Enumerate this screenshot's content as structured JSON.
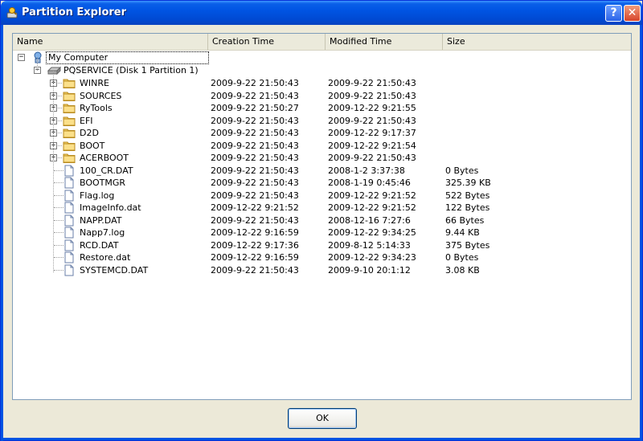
{
  "window": {
    "title": "Partition Explorer",
    "help_label": "?",
    "close_label": "✕"
  },
  "columns": [
    "Name",
    "Creation Time",
    "Modified Time",
    "Size"
  ],
  "tree": {
    "root": {
      "label": "My Computer",
      "expander": "−"
    },
    "partition": {
      "label": "PQSERVICE (Disk 1 Partition 1)",
      "expander": "−"
    }
  },
  "folders": [
    {
      "name": "WINRE",
      "created": "2009-9-22 21:50:43",
      "modified": "2009-9-22 21:50:43",
      "size": ""
    },
    {
      "name": "SOURCES",
      "created": "2009-9-22 21:50:43",
      "modified": "2009-9-22 21:50:43",
      "size": ""
    },
    {
      "name": "RyTools",
      "created": "2009-9-22 21:50:27",
      "modified": "2009-12-22 9:21:55",
      "size": ""
    },
    {
      "name": "EFI",
      "created": "2009-9-22 21:50:43",
      "modified": "2009-9-22 21:50:43",
      "size": ""
    },
    {
      "name": "D2D",
      "created": "2009-9-22 21:50:43",
      "modified": "2009-12-22 9:17:37",
      "size": ""
    },
    {
      "name": "BOOT",
      "created": "2009-9-22 21:50:43",
      "modified": "2009-12-22 9:21:54",
      "size": ""
    },
    {
      "name": "ACERBOOT",
      "created": "2009-9-22 21:50:43",
      "modified": "2009-9-22 21:50:43",
      "size": ""
    }
  ],
  "files": [
    {
      "name": "100_CR.DAT",
      "created": "2009-9-22 21:50:43",
      "modified": "2008-1-2 3:37:38",
      "size": "0 Bytes"
    },
    {
      "name": "BOOTMGR",
      "created": "2009-9-22 21:50:43",
      "modified": "2008-1-19 0:45:46",
      "size": "325.39 KB"
    },
    {
      "name": "Flag.log",
      "created": "2009-9-22 21:50:43",
      "modified": "2009-12-22 9:21:52",
      "size": "522 Bytes"
    },
    {
      "name": "ImageInfo.dat",
      "created": "2009-12-22 9:21:52",
      "modified": "2009-12-22 9:21:52",
      "size": "122 Bytes"
    },
    {
      "name": "NAPP.DAT",
      "created": "2009-9-22 21:50:43",
      "modified": "2008-12-16 7:27:6",
      "size": "66 Bytes"
    },
    {
      "name": "Napp7.log",
      "created": "2009-12-22 9:16:59",
      "modified": "2009-12-22 9:34:25",
      "size": "9.44 KB"
    },
    {
      "name": "RCD.DAT",
      "created": "2009-12-22 9:17:36",
      "modified": "2009-8-12 5:14:33",
      "size": "375 Bytes"
    },
    {
      "name": "Restore.dat",
      "created": "2009-12-22 9:16:59",
      "modified": "2009-12-22 9:34:23",
      "size": "0 Bytes"
    },
    {
      "name": "SYSTEMCD.DAT",
      "created": "2009-9-22 21:50:43",
      "modified": "2009-9-10 20:1:12",
      "size": "3.08 KB"
    }
  ],
  "buttons": {
    "ok_label": "OK"
  },
  "icons": {
    "root": "computer-icon",
    "partition": "drive-icon",
    "folder": "folder-icon",
    "file": "file-icon"
  }
}
